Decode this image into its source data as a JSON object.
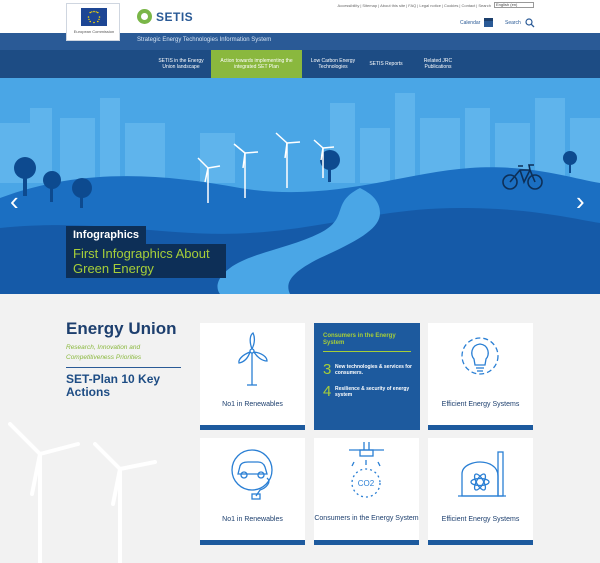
{
  "header": {
    "ec_text": "European Commission",
    "brand": "SETIS",
    "brand_tagline": "Strategic Energy Technologies Information System",
    "utility_links": [
      "Accessibility",
      "Sitemap",
      "About this site",
      "FAQ",
      "Legal notice",
      "Cookies",
      "Contact",
      "Search"
    ],
    "language": "English (en)",
    "calendar_label": "Calendar",
    "search_label": "Search"
  },
  "nav": {
    "items": [
      {
        "label": "SETIS in the Energy Union landscape",
        "active": false
      },
      {
        "label": "Action towards implementing the integrated SET Plan",
        "active": true
      },
      {
        "label": "Low Carbon Energy Technologies",
        "active": false
      },
      {
        "label": "SETIS Reports",
        "active": false
      },
      {
        "label": "Related JRC Publications",
        "active": false
      }
    ]
  },
  "hero": {
    "tag": "Infographics",
    "title": "First Infographics About Green Energy",
    "prev": "‹",
    "next": "›"
  },
  "energy_union": {
    "title": "Energy Union",
    "subtitle": "Research, Innovation and Competitiveness Priorities",
    "set_plan": "SET-Plan 10 Key Actions"
  },
  "cards": {
    "c1": "No1 in Renewables",
    "blue": {
      "title": "Consumers in the Energy System",
      "items": [
        {
          "num": "3",
          "text": "New technologies & services for consumers."
        },
        {
          "num": "4",
          "text": "Resilience & security of energy system"
        }
      ]
    },
    "c3": "Efficient Energy Systems",
    "c4": "No1 in Renewables",
    "c5": "Consumers in the Energy System",
    "c5_icon_text": "CO2",
    "c6": "Efficient Energy Systems"
  },
  "colors": {
    "brand_blue": "#2a5a96",
    "nav_blue": "#1d4c84",
    "accent_green": "#8ab83e",
    "hero_sky": "#4aa6e6"
  }
}
